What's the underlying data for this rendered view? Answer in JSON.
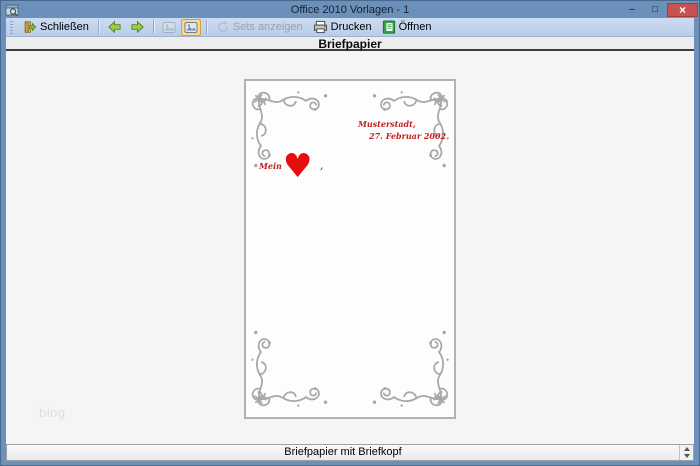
{
  "window": {
    "title": "Office 2010 Vorlagen - 1",
    "minimize_glyph": "−",
    "maximize_glyph": "□",
    "close_glyph": "×"
  },
  "toolbar": {
    "schliessen_label": "Schließen",
    "sets_label": "Sets anzeigen",
    "drucken_label": "Drucken",
    "oeffnen_label": "Öffnen"
  },
  "header": {
    "title": "Briefpapier"
  },
  "letter": {
    "city": "Musterstadt,",
    "date": "27. Februar 2002",
    "greeting": "Mein",
    "heart": "♥",
    "comma": ","
  },
  "watermark": "blog",
  "statusbar": {
    "template_name": "Briefpapier mit Briefkopf"
  },
  "icons": {
    "exit-icon": "open door with green arrow",
    "back-icon": "green arrow left",
    "forward-icon": "green arrow right",
    "view-list-icon": "gray thumbnail (disabled)",
    "view-preview-icon": "thumbnail on orange highlight (selected)",
    "sets-icon": "gray circular arrow (disabled)",
    "printer-icon": "printer",
    "open-doc-icon": "green document",
    "flourish-ornament": "gray vine corner ornament"
  },
  "colors": {
    "titlebar_blue": "#6b90ba",
    "close_button_red": "#c85250",
    "toolbar_blue": "#c3d5ee",
    "selected_orange_bg": "#fcd98c",
    "selected_orange_border": "#d9a03a",
    "letter_red": "#c32020",
    "heart_red": "#e80d0d",
    "flourish_gray": "#a8a8a8",
    "paper_border": "#b2b2b2"
  }
}
